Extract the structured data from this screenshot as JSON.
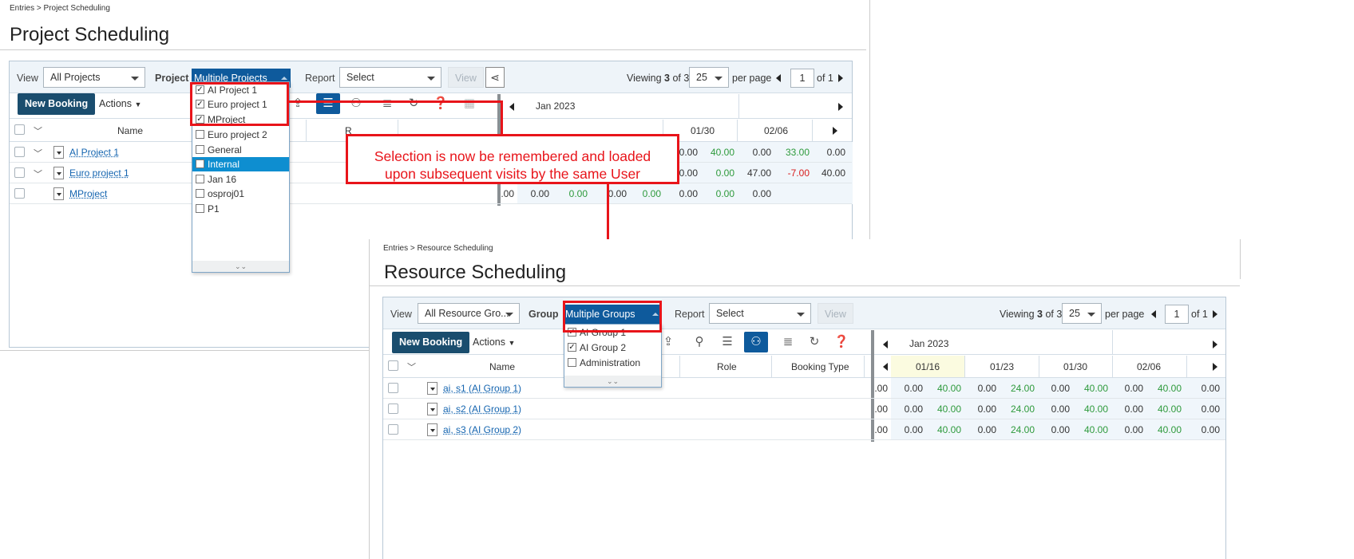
{
  "project": {
    "breadcrumb": "Entries > Project Scheduling",
    "title": "Project Scheduling",
    "filters": {
      "view_label": "View",
      "view_value": "All Projects",
      "project_label": "Project",
      "project_value": "Multiple Projects",
      "report_label": "Report",
      "report_value": "Select",
      "view_button": "View",
      "viewing_prefix": "Viewing",
      "viewing_count": "3",
      "viewing_of": "of 3",
      "per_page_value": "25",
      "per_page_label": "per page",
      "page_value": "1",
      "page_of": "of 1"
    },
    "toolbar": {
      "new_booking": "New Booking",
      "actions": "Actions",
      "month": "Jan 2023"
    },
    "columns": {
      "name": "Name",
      "role_partial": "R"
    },
    "dates": [
      "01/30",
      "02/06"
    ],
    "rows": [
      {
        "name": "AI Project 1",
        "values": [
          "0.00",
          "40.00",
          "0.00",
          "33.00",
          "0.00"
        ]
      },
      {
        "name": "Euro project 1",
        "values": [
          "0.00",
          "0.00",
          "47.00",
          "-7.00",
          "40.00"
        ]
      },
      {
        "name": "MProject",
        "values": [
          ".00",
          "0.00",
          "0.00",
          "0.00",
          "0.00",
          "0.00",
          "0.00",
          "0.00"
        ]
      }
    ],
    "dropdown": [
      {
        "label": "AI Project 1",
        "checked": true
      },
      {
        "label": "Euro project 1",
        "checked": true
      },
      {
        "label": "MProject",
        "checked": true
      },
      {
        "label": "Euro project 2",
        "checked": false
      },
      {
        "label": "General",
        "checked": false
      },
      {
        "label": "Internal",
        "checked": false
      },
      {
        "label": "Jan 16",
        "checked": false
      },
      {
        "label": "osproj01",
        "checked": false
      },
      {
        "label": "P1",
        "checked": false
      }
    ]
  },
  "callout": {
    "line1": "Selection is now be remembered and loaded",
    "line2": "upon subsequent visits by the same User"
  },
  "resource": {
    "breadcrumb": "Entries > Resource Scheduling",
    "title": "Resource Scheduling",
    "filters": {
      "view_label": "View",
      "view_value": "All Resource Gro...",
      "group_label": "Group",
      "group_value": "Multiple Groups",
      "report_label": "Report",
      "report_value": "Select",
      "view_button": "View",
      "viewing_prefix": "Viewing",
      "viewing_count": "3",
      "viewing_of": "of 3",
      "per_page_value": "25",
      "per_page_label": "per page",
      "page_value": "1",
      "page_of": "of 1"
    },
    "toolbar": {
      "new_booking": "New Booking",
      "actions": "Actions",
      "month": "Jan 2023"
    },
    "columns": {
      "name": "Name",
      "role": "Role",
      "booking_type": "Booking Type"
    },
    "dates": [
      "01/16",
      "01/23",
      "01/30",
      "02/06"
    ],
    "rows": [
      {
        "name": "ai, s1 (AI Group 1)",
        "values": [
          ".00",
          "0.00",
          "40.00",
          "0.00",
          "24.00",
          "0.00",
          "40.00",
          "0.00",
          "40.00",
          "0.00"
        ]
      },
      {
        "name": "ai, s2 (AI Group 1)",
        "values": [
          ".00",
          "0.00",
          "40.00",
          "0.00",
          "24.00",
          "0.00",
          "40.00",
          "0.00",
          "40.00",
          "0.00"
        ]
      },
      {
        "name": "ai, s3 (AI Group 2)",
        "values": [
          ".00",
          "0.00",
          "40.00",
          "0.00",
          "24.00",
          "0.00",
          "40.00",
          "0.00",
          "40.00",
          "0.00"
        ]
      }
    ],
    "dropdown": [
      {
        "label": "AI Group 1",
        "checked": true
      },
      {
        "label": "AI Group 2",
        "checked": true
      },
      {
        "label": "Administration",
        "checked": false
      }
    ]
  },
  "colors": {
    "accent": "#0e5a9c",
    "highlight": "#e8141a",
    "positive": "#2e9a3c",
    "negative": "#d81d1d"
  }
}
